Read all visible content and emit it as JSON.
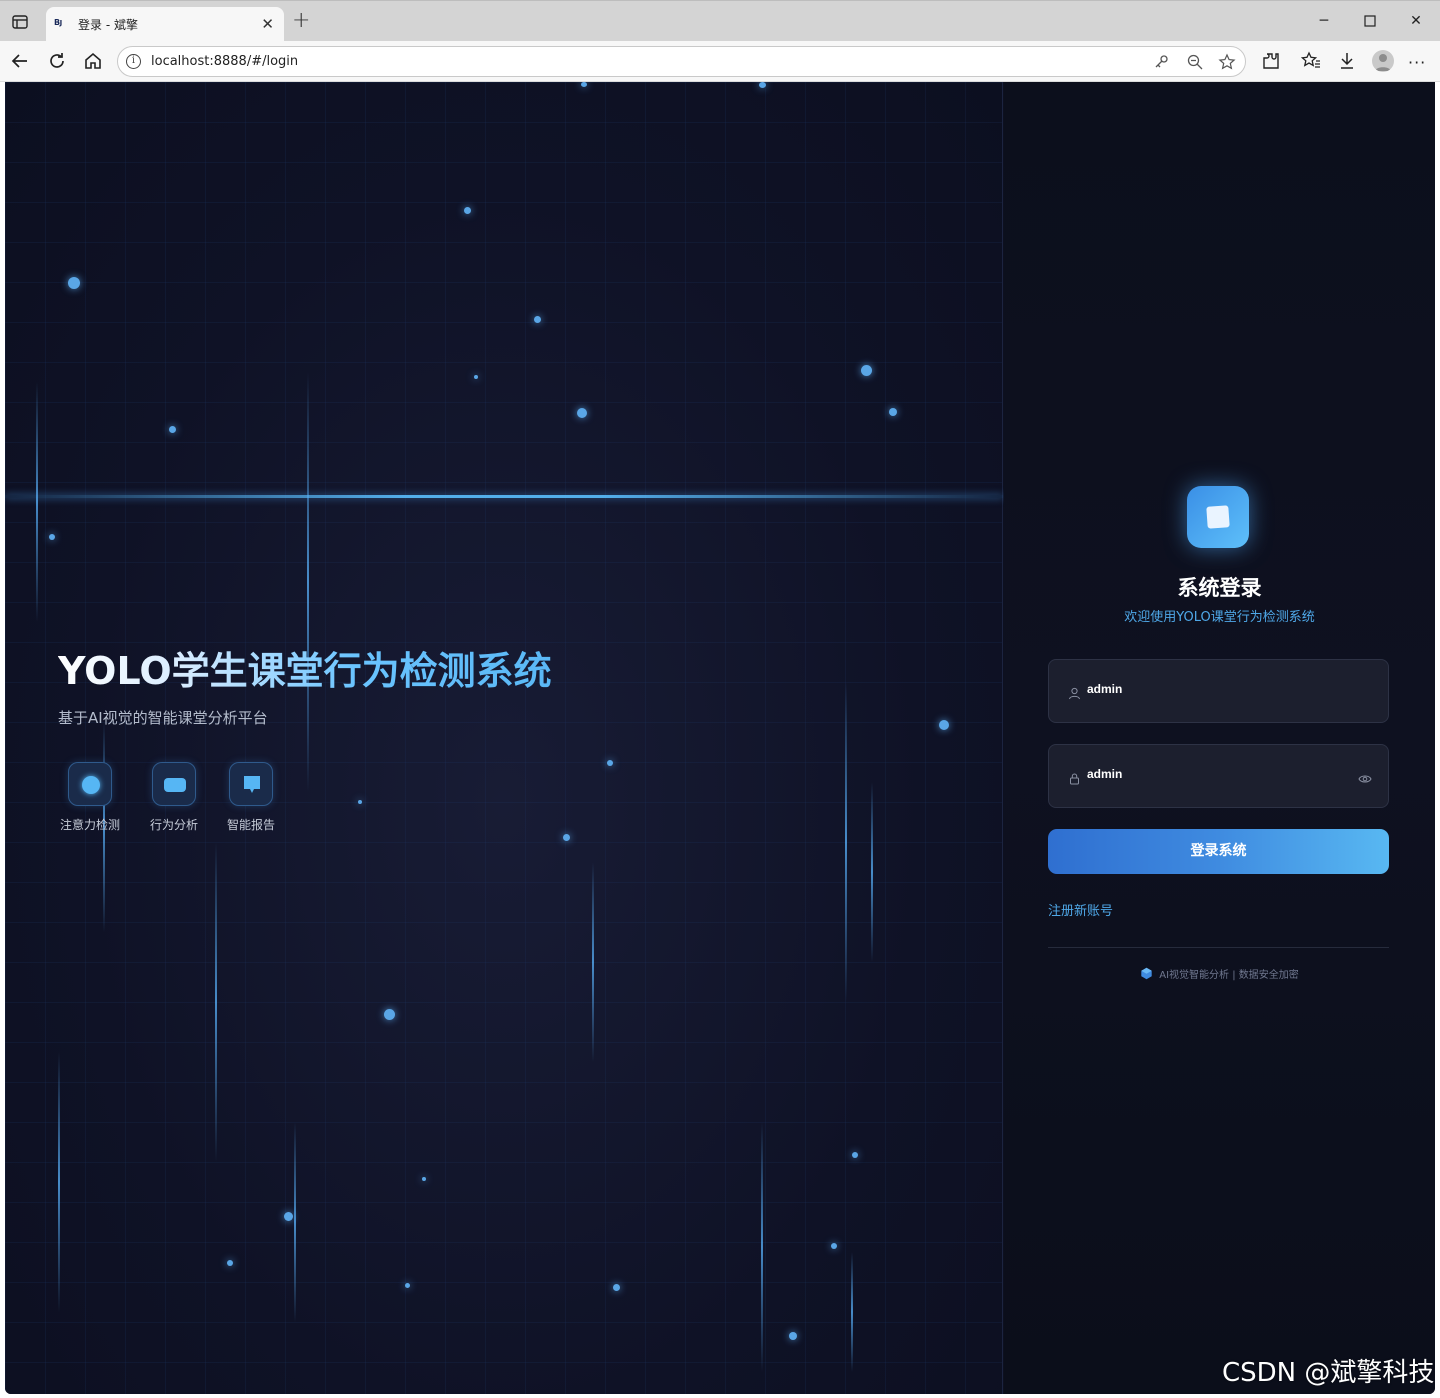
{
  "browser": {
    "tab_title": "登录 - 斌擎",
    "tab_favicon": "B",
    "url": "localhost:8888/#/login"
  },
  "hero": {
    "title": "YOLO学生课堂行为检测系统",
    "subtitle": "基于AI视觉的智能课堂分析平台",
    "features": [
      {
        "label": "注意力检测",
        "icon": "circle-icon"
      },
      {
        "label": "行为分析",
        "icon": "screen-icon"
      },
      {
        "label": "智能报告",
        "icon": "report-icon"
      }
    ]
  },
  "login": {
    "title": "系统登录",
    "subtitle": "欢迎使用YOLO课堂行为检测系统",
    "username_value": "admin",
    "password_value": "admin",
    "submit_label": "登录系统",
    "register_label": "注册新账号",
    "footer_text": "AI视觉智能分析 | 数据安全加密"
  },
  "watermark": "CSDN @斌擎科技",
  "colors": {
    "accent": "#4fa8e8",
    "button_gradient_start": "#2f6fd0",
    "button_gradient_end": "#58b8f2",
    "page_background": "#0d1020"
  }
}
